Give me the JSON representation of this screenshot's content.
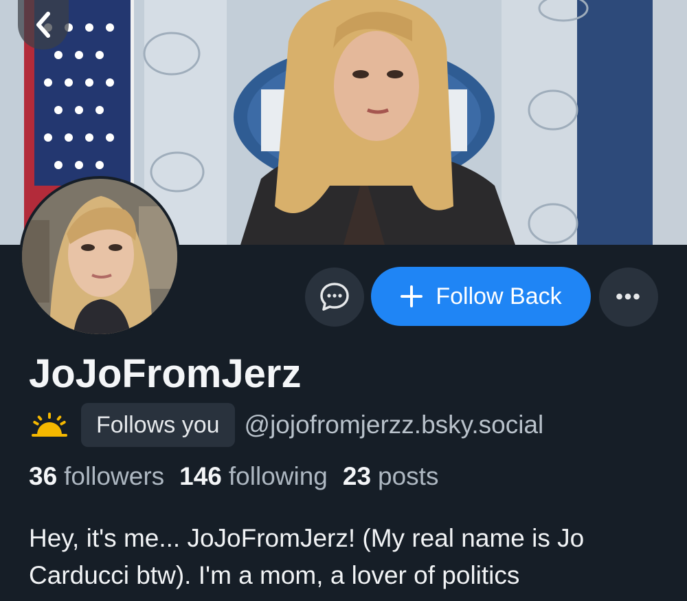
{
  "profile": {
    "display_name": "JoJoFromJerz",
    "follows_you": "Follows you",
    "handle": "@jojofromjerzz.bsky.social",
    "stats": {
      "followers_count": "36",
      "followers_label": "followers",
      "following_count": "146",
      "following_label": "following",
      "posts_count": "23",
      "posts_label": "posts"
    },
    "bio": "Hey, it's me... JoJoFromJerz! (My real name is Jo Carducci btw). I'm a mom, a lover of politics"
  },
  "actions": {
    "follow_back_label": "Follow Back",
    "more_label": "•••"
  },
  "icons": {
    "back": "chevron-left-icon",
    "message": "chat-bubble-icon",
    "plus": "plus-icon",
    "more": "ellipsis-icon",
    "sun": "sunrise-icon"
  },
  "colors": {
    "background": "#161e27",
    "accent": "#1f85f5",
    "button_dark": "#29323d",
    "sun": "#f5b800"
  }
}
